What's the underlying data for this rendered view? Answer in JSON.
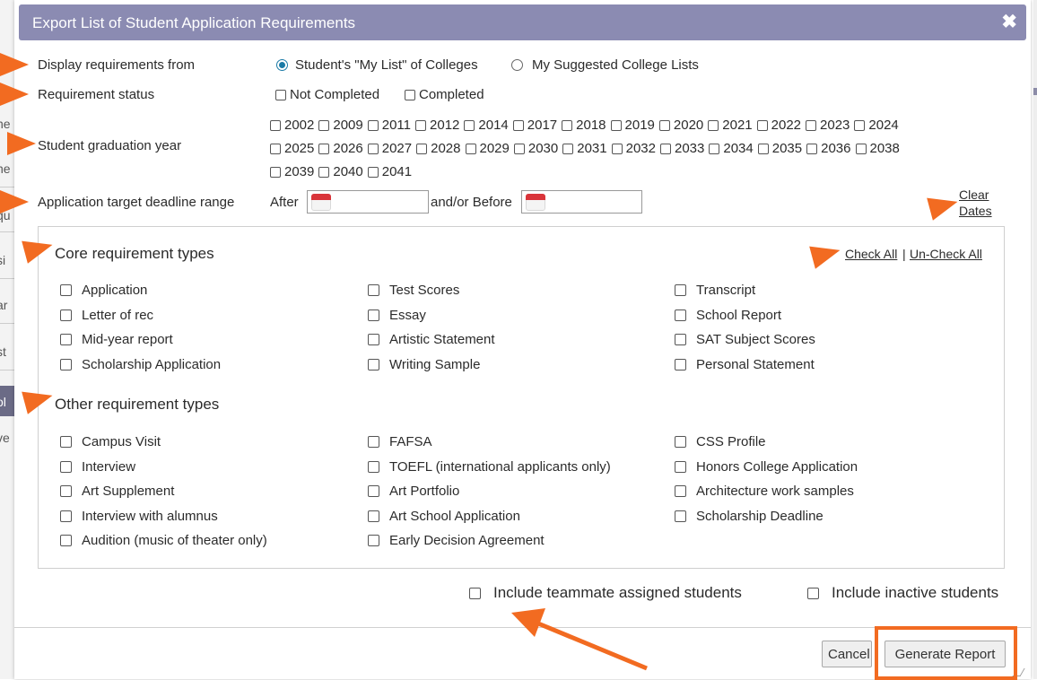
{
  "dialog": {
    "title": "Export List of Student Application Requirements",
    "close_glyph": "✖"
  },
  "display": {
    "label": "Display requirements from",
    "option_my_list": "Student's \"My List\" of Colleges",
    "option_suggested": "My Suggested College Lists",
    "selected": "my_list"
  },
  "status": {
    "label": "Requirement status",
    "not_completed": "Not Completed",
    "completed": "Completed"
  },
  "graduation": {
    "label": "Student graduation year",
    "years": [
      "2002",
      "2009",
      "2011",
      "2012",
      "2014",
      "2017",
      "2018",
      "2019",
      "2020",
      "2021",
      "2022",
      "2023",
      "2024",
      "2025",
      "2026",
      "2027",
      "2028",
      "2029",
      "2030",
      "2031",
      "2032",
      "2033",
      "2034",
      "2035",
      "2036",
      "2038",
      "2039",
      "2040",
      "2041"
    ]
  },
  "deadline": {
    "label": "Application target deadline range",
    "after": "After",
    "before": "and/or Before",
    "after_value": "",
    "before_value": "",
    "clear_line1": "Clear",
    "clear_line2": "Dates"
  },
  "core": {
    "title": "Core requirement types",
    "check_all": "Check All",
    "separator": "|",
    "uncheck_all": "Un-Check All",
    "col1": [
      "Application",
      "Letter of rec",
      "Mid-year report",
      "Scholarship Application"
    ],
    "col2": [
      "Test Scores",
      "Essay",
      "Artistic Statement",
      "Writing Sample"
    ],
    "col3": [
      "Transcript",
      "School Report",
      "SAT Subject Scores",
      "Personal Statement"
    ]
  },
  "other": {
    "title": "Other requirement types",
    "col1": [
      "Campus Visit",
      "Interview",
      "Art Supplement",
      "Interview with alumnus",
      "Audition (music of theater only)"
    ],
    "col2": [
      "FAFSA",
      "TOEFL (international applicants only)",
      "Art Portfolio",
      "Art School Application",
      "Early Decision Agreement"
    ],
    "col3": [
      "CSS Profile",
      "Honors College Application",
      "Architecture work samples",
      "Scholarship Deadline"
    ]
  },
  "options": {
    "teammate": "Include teammate assigned students",
    "inactive": "Include inactive students"
  },
  "buttons": {
    "cancel": "Cancel",
    "generate": "Generate Report"
  },
  "background_fragments": [
    "he",
    "he",
    "qu",
    "si",
    "ar",
    "st",
    "ol",
    "ve"
  ],
  "colors": {
    "titlebar": "#8b8bb2",
    "accent_arrow": "#f26b21",
    "radio_selected": "#1a7aa6"
  }
}
